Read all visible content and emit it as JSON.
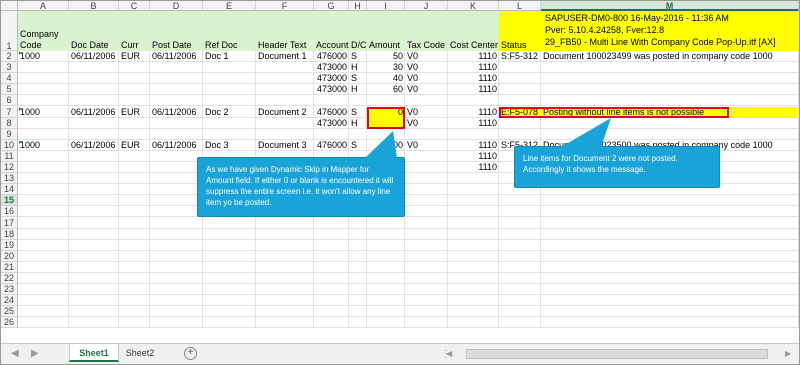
{
  "columns": [
    "A",
    "B",
    "C",
    "D",
    "E",
    "F",
    "G",
    "H",
    "I",
    "J",
    "K",
    "L",
    "M"
  ],
  "selected_column": "M",
  "selected_row": "15",
  "row_numbers": [
    "1",
    "2",
    "3",
    "4",
    "5",
    "6",
    "7",
    "8",
    "9",
    "10",
    "11",
    "12",
    "13",
    "14",
    "15",
    "16",
    "17",
    "18",
    "19",
    "20",
    "21",
    "22",
    "23",
    "24",
    "25",
    "26"
  ],
  "header_row": {
    "company_code": "Company Code",
    "doc_date": "Doc Date",
    "curr": "Curr",
    "post_date": "Post Date",
    "ref_doc": "Ref Doc",
    "header_text": "Header Text",
    "account": "Account",
    "dc": "D/C",
    "amount": "Amount",
    "tax_code": "Tax Code",
    "cost_center": "Cost Center",
    "status": "Status",
    "info_line1": "SAPUSER-DM0-800 16-May-2016 - 11:36 AM",
    "info_line2": "Pver: 5.10.4.24258, Fver:12.8",
    "info_line3": "29_FB50 - Multi Line With Company Code Pop-Up.itf [AX]"
  },
  "data_rows": [
    {
      "row": "2",
      "company": "1000",
      "doc_date": "06/11/2006",
      "curr": "EUR",
      "post_date": "06/11/2006",
      "ref_doc": "Doc 1",
      "header_text": "Document 1",
      "account": "476000",
      "dc": "S",
      "amount": "50",
      "tax": "V0",
      "cost_center": "1110",
      "status": "S:F5-312",
      "message": "Document 100023499 was posted in company code 1000"
    },
    {
      "row": "3",
      "company": "",
      "doc_date": "",
      "curr": "",
      "post_date": "",
      "ref_doc": "",
      "header_text": "",
      "account": "473000",
      "dc": "H",
      "amount": "30",
      "tax": "V0",
      "cost_center": "1110",
      "status": "",
      "message": ""
    },
    {
      "row": "4",
      "company": "",
      "doc_date": "",
      "curr": "",
      "post_date": "",
      "ref_doc": "",
      "header_text": "",
      "account": "473000",
      "dc": "S",
      "amount": "40",
      "tax": "V0",
      "cost_center": "1110",
      "status": "",
      "message": ""
    },
    {
      "row": "5",
      "company": "",
      "doc_date": "",
      "curr": "",
      "post_date": "",
      "ref_doc": "",
      "header_text": "",
      "account": "473000",
      "dc": "H",
      "amount": "60",
      "tax": "V0",
      "cost_center": "1110",
      "status": "",
      "message": ""
    },
    {
      "row": "7",
      "company": "1000",
      "doc_date": "06/11/2006",
      "curr": "EUR",
      "post_date": "06/11/2006",
      "ref_doc": "Doc 2",
      "header_text": "Document 2",
      "account": "476000",
      "dc": "S",
      "amount": "0",
      "tax": "V0",
      "cost_center": "1110",
      "status": "E:F5-078",
      "message": "Posting without line items is not possible"
    },
    {
      "row": "8",
      "company": "",
      "doc_date": "",
      "curr": "",
      "post_date": "",
      "ref_doc": "",
      "header_text": "",
      "account": "473000",
      "dc": "H",
      "amount": "",
      "tax": "V0",
      "cost_center": "1110",
      "status": "",
      "message": ""
    },
    {
      "row": "10",
      "company": "1000",
      "doc_date": "06/11/2006",
      "curr": "EUR",
      "post_date": "06/11/2006",
      "ref_doc": "Doc 3",
      "header_text": "Document 3",
      "account": "476000",
      "dc": "S",
      "amount": "8000",
      "tax": "V0",
      "cost_center": "1110",
      "status": "S:F5-312",
      "message": "Document 100023500 was posted in company code 1000"
    },
    {
      "row": "11",
      "company": "",
      "doc_date": "",
      "curr": "",
      "post_date": "",
      "ref_doc": "",
      "header_text": "",
      "account": "",
      "dc": "",
      "amount": "",
      "tax": "",
      "cost_center": "1110",
      "status": "",
      "message": ""
    },
    {
      "row": "12",
      "company": "",
      "doc_date": "",
      "curr": "",
      "post_date": "",
      "ref_doc": "",
      "header_text": "",
      "account": "",
      "dc": "",
      "amount": "",
      "tax": "",
      "cost_center": "1110",
      "status": "",
      "message": ""
    }
  ],
  "callout_left": "As we have given Dynamic Skip in Mapper for Amount field. If either 0 or blank is encountered it will suppress the entire screen i.e. it won't allow any line item yo be posted.",
  "callout_right": "Line items for Document 2 were not posted. Accordingly it shows the message.",
  "sheet_tabs": [
    "Sheet1",
    "Sheet2"
  ],
  "active_sheet": "Sheet1",
  "colors": {
    "header_green": "#d9f2cf",
    "info_yellow": "#ffff00",
    "error_red": "#e0001b",
    "callout_blue": "#1aa3d9",
    "excel_green": "#217346"
  }
}
